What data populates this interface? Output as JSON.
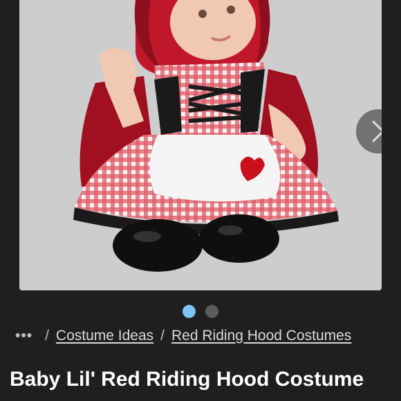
{
  "product": {
    "image_alt": "Baby in red riding hood costume",
    "title": "Baby Lil' Red Riding Hood Costume"
  },
  "gallery": {
    "next_icon": "chevron-right-icon",
    "dot_count": 2,
    "active_index": 0
  },
  "breadcrumb": {
    "more": "•••",
    "separator": "/",
    "items": [
      "Costume Ideas",
      "Red Riding Hood Costumes"
    ]
  },
  "colors": {
    "accent_dot": "#7cc4f5",
    "background": "#1f1f1f"
  }
}
